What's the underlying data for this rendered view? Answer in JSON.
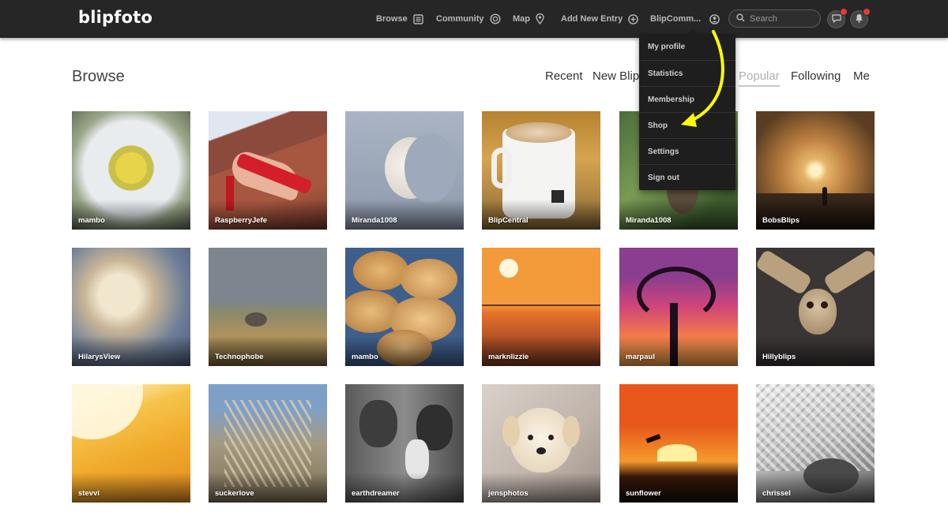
{
  "header": {
    "logo": "blipfoto",
    "nav": [
      {
        "label": "Browse",
        "icon": "list-icon"
      },
      {
        "label": "Community",
        "icon": "chat-bubbles-icon"
      },
      {
        "label": "Map",
        "icon": "map-pin-icon"
      },
      {
        "label": "Add New Entry",
        "icon": "plus-circle-icon"
      },
      {
        "label": "BlipComm...",
        "icon": "user-circle-icon"
      }
    ],
    "search_placeholder": "Search",
    "notifications": [
      {
        "icon": "messages-icon",
        "badge": true
      },
      {
        "icon": "bell-icon",
        "badge": true
      }
    ]
  },
  "page": {
    "title": "Browse",
    "tabs": [
      "Recent",
      "New Blip",
      "Popular",
      "Following",
      "Me"
    ],
    "active_tab": "Popular"
  },
  "dropdown": {
    "items": [
      "My profile",
      "Statistics",
      "Membership",
      "Shop",
      "Settings",
      "Sign out"
    ]
  },
  "annotation_color": "#ffff00",
  "photos": [
    {
      "user": "mambo",
      "subject": "yellow flower stamens"
    },
    {
      "user": "RaspberryJefe",
      "subject": "red sandal on foot"
    },
    {
      "user": "Miranda1008",
      "subject": "half moon in grey sky"
    },
    {
      "user": "BlipCentral",
      "subject": "coffee mug"
    },
    {
      "user": "Miranda1008",
      "subject": "bird on branch"
    },
    {
      "user": "BobsBlips",
      "subject": "sunset with figure"
    },
    {
      "user": "HilarysView",
      "subject": "clouds"
    },
    {
      "user": "Technophobe",
      "subject": "bird over field"
    },
    {
      "user": "mambo",
      "subject": "cookies"
    },
    {
      "user": "marknlizzie",
      "subject": "orange sea sunset with birds"
    },
    {
      "user": "marpaul",
      "subject": "tree silhouette at sunset"
    },
    {
      "user": "Hillyblips",
      "subject": "owl in flight"
    },
    {
      "user": "stevvi",
      "subject": "yellow sun abstract"
    },
    {
      "user": "suckerlove",
      "subject": "grass seed heads"
    },
    {
      "user": "earthdreamer",
      "subject": "two women black and white"
    },
    {
      "user": "jensphotos",
      "subject": "puppy"
    },
    {
      "user": "sunflower",
      "subject": "orange sunset with bird"
    },
    {
      "user": "chrissel",
      "subject": "cat under blanket"
    }
  ]
}
